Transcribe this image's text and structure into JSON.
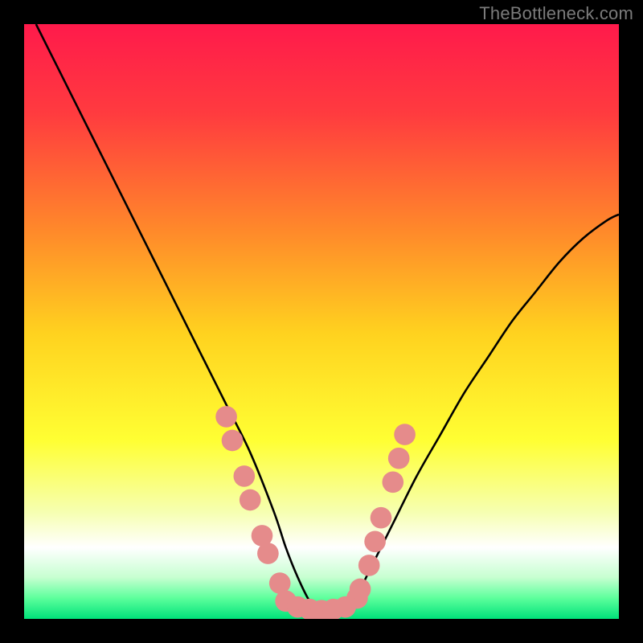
{
  "watermark": "TheBottleneck.com",
  "chart_data": {
    "type": "line",
    "title": "",
    "xlabel": "",
    "ylabel": "",
    "xlim": [
      0,
      100
    ],
    "ylim": [
      0,
      100
    ],
    "grid": false,
    "legend": false,
    "background_gradient_stops": [
      {
        "offset": 0.0,
        "color": "#ff1a4b"
      },
      {
        "offset": 0.15,
        "color": "#ff3b3f"
      },
      {
        "offset": 0.35,
        "color": "#ff8a2a"
      },
      {
        "offset": 0.52,
        "color": "#ffd21f"
      },
      {
        "offset": 0.7,
        "color": "#ffff33"
      },
      {
        "offset": 0.82,
        "color": "#f6ffb0"
      },
      {
        "offset": 0.88,
        "color": "#ffffff"
      },
      {
        "offset": 0.93,
        "color": "#c7ffd1"
      },
      {
        "offset": 0.965,
        "color": "#5dff9c"
      },
      {
        "offset": 1.0,
        "color": "#00e27a"
      }
    ],
    "series": [
      {
        "name": "bottleneck-curve",
        "color": "#000000",
        "x": [
          2,
          6,
          10,
          14,
          18,
          22,
          26,
          30,
          34,
          38,
          42,
          44,
          46,
          48,
          50,
          52,
          54,
          56,
          58,
          62,
          66,
          70,
          74,
          78,
          82,
          86,
          90,
          94,
          98,
          100
        ],
        "y": [
          100,
          92,
          84,
          76,
          68,
          60,
          52,
          44,
          36,
          28,
          18,
          12,
          7,
          3,
          1,
          1,
          2,
          4,
          8,
          16,
          24,
          31,
          38,
          44,
          50,
          55,
          60,
          64,
          67,
          68
        ]
      }
    ],
    "markers": {
      "name": "highlight-dots",
      "color": "#e58b8b",
      "radius": 1.8,
      "points_xy": [
        [
          34,
          34
        ],
        [
          35,
          30
        ],
        [
          37,
          24
        ],
        [
          38,
          20
        ],
        [
          40,
          14
        ],
        [
          41,
          11
        ],
        [
          43,
          6
        ],
        [
          44,
          3
        ],
        [
          46,
          2
        ],
        [
          48,
          1.6
        ],
        [
          50,
          1.4
        ],
        [
          52,
          1.6
        ],
        [
          54,
          2
        ],
        [
          56,
          3.5
        ],
        [
          56.5,
          5
        ],
        [
          58,
          9
        ],
        [
          59,
          13
        ],
        [
          60,
          17
        ],
        [
          62,
          23
        ],
        [
          63,
          27
        ],
        [
          64,
          31
        ]
      ]
    }
  }
}
